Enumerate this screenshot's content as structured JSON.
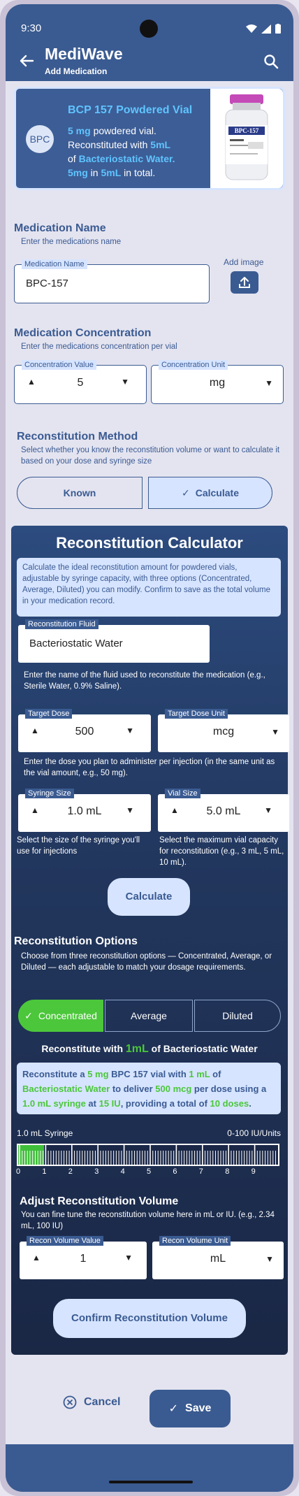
{
  "status_bar": {
    "time": "9:30"
  },
  "app": {
    "name": "MediWave",
    "subtitle": "Add Medication"
  },
  "summary_card": {
    "badge": "BPC",
    "title": "BCP 157 Powdered Vial",
    "line1_a": "5 mg",
    "line1_b": " powdered vial.",
    "line2_a": "Reconstituted with ",
    "line2_b": "5mL",
    "line3_a": "of ",
    "line3_b": "Bacteriostatic Water.",
    "line4_a": "5mg",
    "line4_b": " in ",
    "line4_c": "5mL",
    "line4_d": " in total.",
    "vial_label": "BPC-157"
  },
  "medication_name": {
    "heading": "Medication Name",
    "subtitle": "Enter the medications name",
    "field_label": "Medication Name",
    "value": "BPC-157",
    "add_image_label": "Add image"
  },
  "concentration": {
    "heading": "Medication Concentration",
    "subtitle": "Enter the medications concentration per vial",
    "value_label": "Concentration Value",
    "value": "5",
    "unit_label": "Concentration Unit",
    "unit": "mg"
  },
  "reconstitution_method": {
    "heading": "Reconstitution Method",
    "subtitle": "Select whether you know the reconstitution volume or want to calculate it based on your dose and syringe size",
    "options": [
      "Known",
      "Calculate"
    ],
    "selected": "Calculate"
  },
  "calculator": {
    "title": "Reconstitution Calculator",
    "intro": "Calculate the ideal reconstitution amount for powdered vials, adjustable by syringe capacity, with three options (Concentrated, Average, Diluted) you can modify. Confirm to save as the total volume in your medication record.",
    "fluid_label": "Reconstitution Fluid",
    "fluid_value": "Bacteriostatic Water",
    "fluid_help": "Enter the name of the fluid used to reconstitute the medication (e.g., Sterile Water, 0.9% Saline).",
    "dose_label": "Target Dose",
    "dose_value": "500",
    "dose_unit_label": "Target Dose Unit",
    "dose_unit": "mcg",
    "dose_help": "Enter the dose you plan to administer per injection (in the same unit as the vial amount, e.g., 50 mg).",
    "syringe_label": "Syringe Size",
    "syringe_value": "1.0 mL",
    "syringe_help": "Select the size of the syringe you'll use for injections",
    "vial_label": "Vial Size",
    "vial_value": "5.0 mL",
    "vial_help": "Select the maximum vial capacity for reconstitution (e.g., 3 mL, 5 mL, 10 mL).",
    "calculate_button": "Calculate"
  },
  "options": {
    "heading": "Reconstitution Options",
    "subtitle": "Choose from three reconstitution options — Concentrated, Average, or Diluted — each adjustable to match your dosage requirements.",
    "tabs": [
      "Concentrated",
      "Average",
      "Diluted"
    ],
    "selected": "Concentrated",
    "result_a": "Reconstitute with ",
    "result_b": "1mL",
    "result_c": " of Bacteriostatic Water",
    "detail": {
      "p1": "Reconstitute a ",
      "p2": "5 mg",
      "p3": " BPC 157 vial with ",
      "p4": "1 mL",
      "p5": " of ",
      "p6": "Bacteriostatic Water",
      "p7": " to deliver ",
      "p8": "500 mcg",
      "p9": " per dose using a ",
      "p10": "1.0 mL syringe",
      "p11": " at ",
      "p12": "15 IU",
      "p13": ", providing a total of ",
      "p14": "10 doses",
      "p15": "."
    }
  },
  "syringe_ruler": {
    "left_label": "1.0 mL Syringe",
    "right_label": "0-100  IU/Units",
    "fill_fraction": 0.1,
    "ticks": [
      "0",
      "1",
      "2",
      "3",
      "4",
      "5",
      "6",
      "7",
      "8",
      "9"
    ]
  },
  "adjust": {
    "heading": "Adjust Reconstitution Volume",
    "subtitle": "You can fine tune the reconstitution volume here in mL or IU. (e.g., 2.34 mL, 100 IU)",
    "value_label": "Recon Volume Value",
    "value": "1",
    "unit_label": "Recon Volume Unit",
    "unit": "mL",
    "confirm_button": "Confirm Reconstitution Volume"
  },
  "footer": {
    "cancel": "Cancel",
    "save": "Save"
  },
  "colors": {
    "primary": "#3a5a92",
    "accent": "#5fc4ff",
    "success": "#4cc63a",
    "light": "#d6e4ff"
  }
}
